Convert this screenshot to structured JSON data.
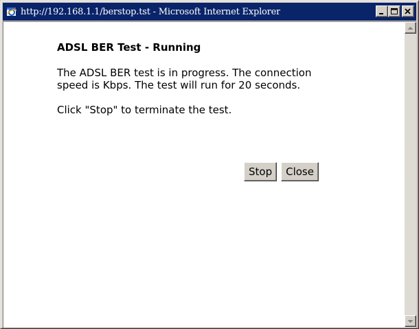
{
  "window": {
    "title": "http://192.168.1.1/berstop.tst - Microsoft Internet Explorer",
    "icon": "ie-icon",
    "controls": [
      "minimize-icon",
      "maximize-icon",
      "close-icon"
    ]
  },
  "page": {
    "heading": "ADSL BER Test - Running",
    "paragraph1": "The ADSL BER test is in progress. The connection speed is   Kbps. The test will run for 20 seconds.",
    "paragraph2": "Click \"Stop\" to terminate the test."
  },
  "actions": {
    "stop_label": "Stop",
    "close_label": "Close"
  },
  "colors": {
    "titlebar": "#0a246a",
    "chrome": "#d4d0c8",
    "content_bg": "#ffffff"
  }
}
